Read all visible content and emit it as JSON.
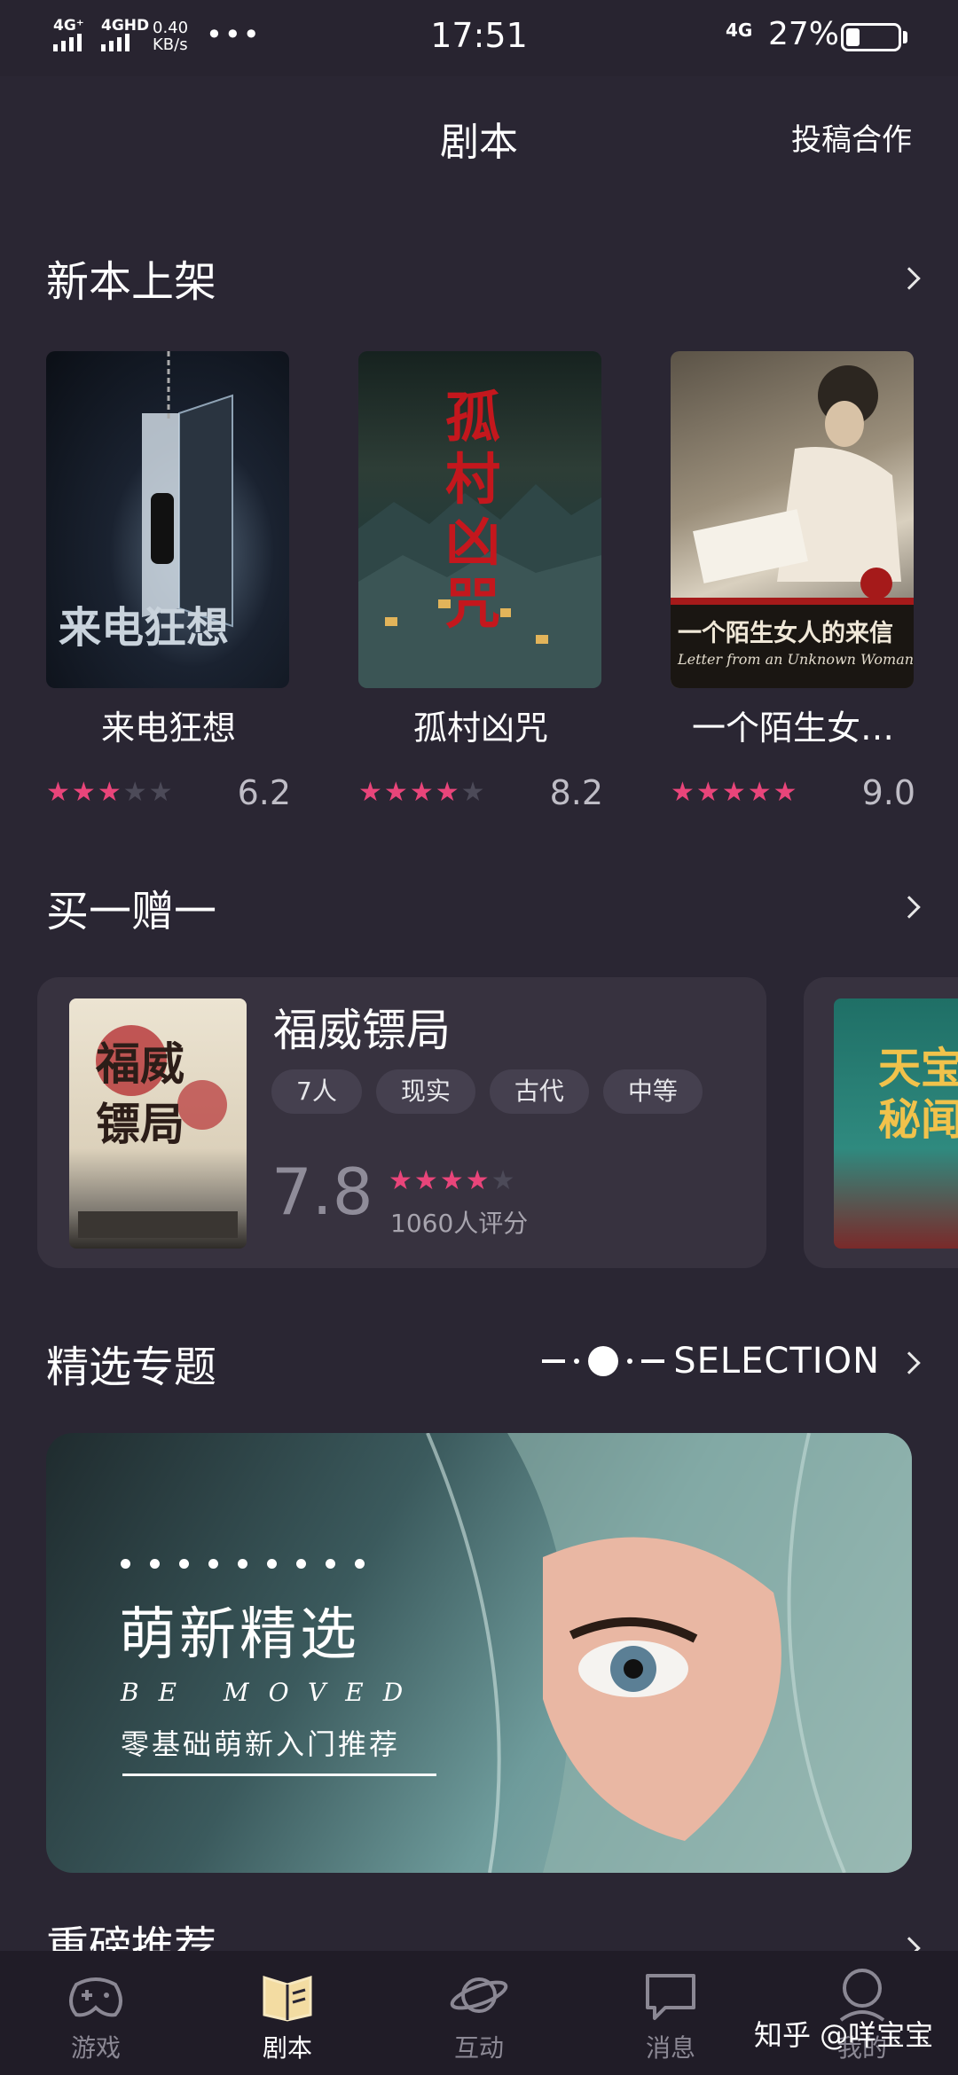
{
  "status_bar": {
    "network1": "4G⁺",
    "network2": "4GHD",
    "speed": "0.40",
    "speed_unit": "KB/s",
    "dots": "•••",
    "time": "17:51",
    "network3": "4G",
    "battery_text": "27%",
    "battery_level": 0.27
  },
  "header": {
    "title": "剧本",
    "action": "投稿合作"
  },
  "new_releases": {
    "title": "新本上架",
    "books": [
      {
        "title": "来电狂想",
        "cover_text": "来电狂想",
        "score": "6.2",
        "stars": 3
      },
      {
        "title": "孤村凶咒",
        "cover_text": "孤村凶咒",
        "score": "8.2",
        "stars": 4
      },
      {
        "title": "一个陌生女…",
        "cover_text": "一个陌生女人的来信",
        "cover_subtitle": "Letter from an Unknown Woman",
        "score": "9.0",
        "stars": 5
      }
    ]
  },
  "bogo": {
    "title": "买一赠一",
    "card": {
      "title": "福威镖局",
      "cover_text": "福威镖局",
      "tags": [
        "7人",
        "现实",
        "古代",
        "中等"
      ],
      "score": "7.8",
      "stars": 4,
      "count": "1060人评分"
    },
    "card2": {
      "cover_text": "天宝秘闻"
    }
  },
  "selection": {
    "title": "精选专题",
    "en_label": "SELECTION",
    "banner": {
      "title": "萌新精选",
      "en": "BE MOVED",
      "subtitle": "零基础萌新入门推荐"
    }
  },
  "next_section": {
    "title": "重磅推荐"
  },
  "nav": {
    "items": [
      {
        "label": "游戏",
        "icon": "gamepad-icon"
      },
      {
        "label": "剧本",
        "icon": "book-icon"
      },
      {
        "label": "互动",
        "icon": "planet-icon"
      },
      {
        "label": "消息",
        "icon": "message-icon"
      },
      {
        "label": "我的",
        "icon": "profile-icon"
      }
    ]
  },
  "watermark": "知乎 @咩宝宝",
  "colors": {
    "background": "#2a2633",
    "star_active": "#e9457a",
    "star_inactive": "#4c4a58",
    "card": "#37323f"
  }
}
